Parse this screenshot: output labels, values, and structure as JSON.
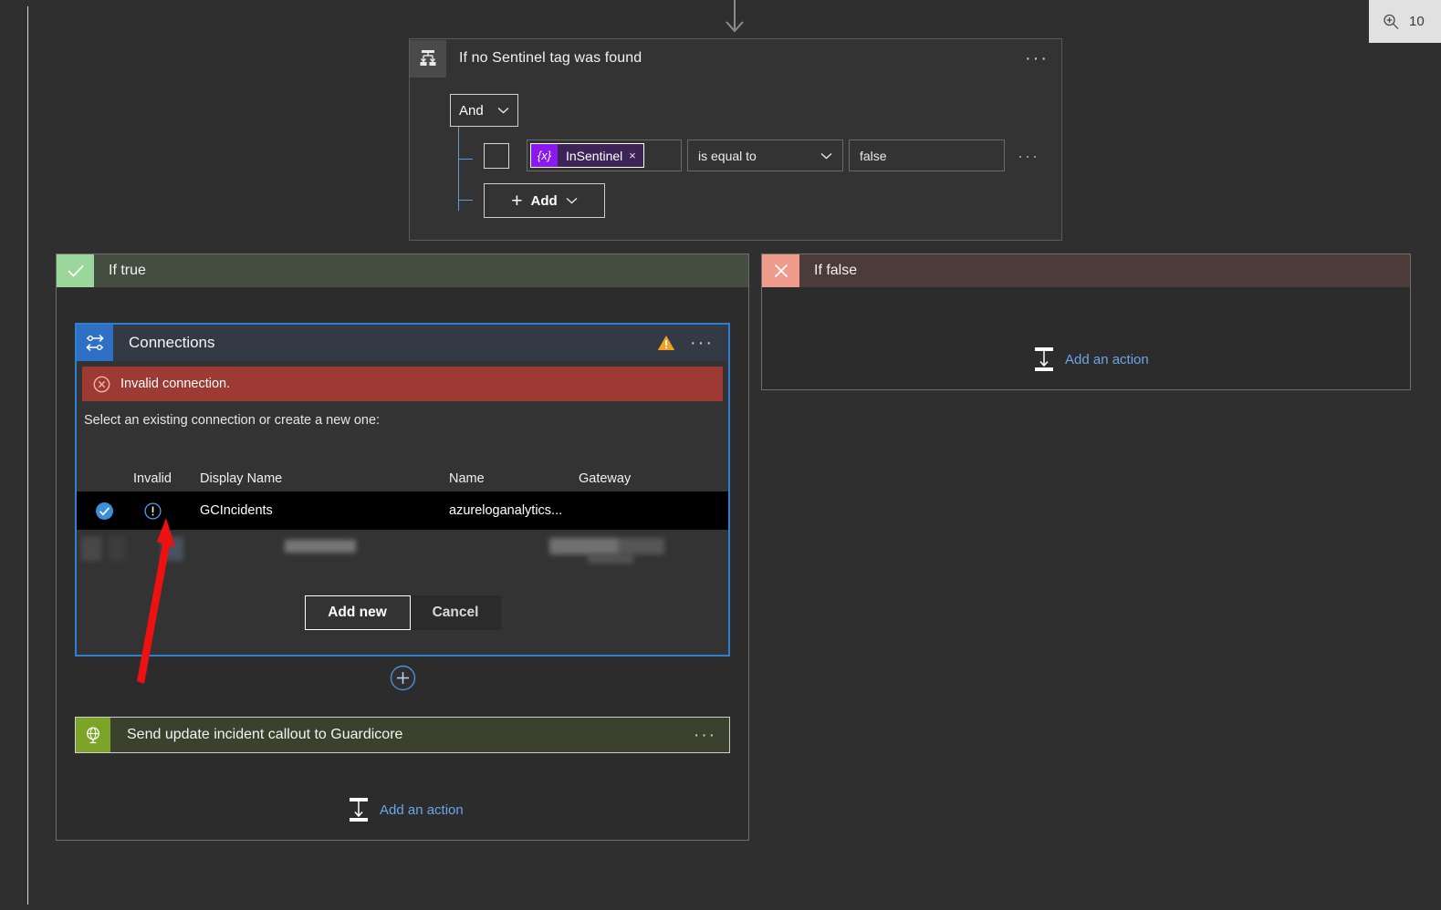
{
  "zoom_control": {
    "icon": "magnifier-plus-icon",
    "level": "10"
  },
  "condition_card": {
    "icon": "condition-icon",
    "title": "If no Sentinel tag was found",
    "more_label": "···",
    "logic_operator": "And",
    "row": {
      "token_icon": "{x}",
      "token_label": "InSentinel",
      "token_remove": "×",
      "operator": "is equal to",
      "value": "false",
      "more_label": "···"
    },
    "add_button": {
      "plus": "+",
      "label": "Add"
    }
  },
  "branches": {
    "true_branch": {
      "icon": "check-icon",
      "title": "If true",
      "add_action_label": "Add an action",
      "add_action_icon": "add-action-icon"
    },
    "false_branch": {
      "icon": "close-x-icon",
      "title": "If false",
      "add_action_label": "Add an action",
      "add_action_icon": "add-action-icon"
    }
  },
  "connections_panel": {
    "icon": "connections-icon",
    "title": "Connections",
    "warning_icon": "warning-triangle-icon",
    "more_label": "···",
    "error": {
      "icon": "error-circle-x-icon",
      "message": "Invalid connection."
    },
    "instruction": "Select an existing connection or create a new one:",
    "table": {
      "columns": [
        "",
        "Invalid",
        "Display Name",
        "Name",
        "Gateway"
      ],
      "rows": [
        {
          "selected": true,
          "select_icon": "checked-radio-icon",
          "invalid_icon": "invalid-exclamation-icon",
          "display_name": "GCIncidents",
          "name": "azureloganalytics...",
          "gateway": ""
        },
        {
          "selected": false,
          "redacted": true,
          "display_name": "",
          "name": "",
          "gateway": ""
        }
      ]
    },
    "buttons": {
      "add_new": "Add new",
      "cancel": "Cancel"
    }
  },
  "insert_node": {
    "icon": "plus-circle-icon",
    "label": "+"
  },
  "guardicore_action": {
    "icon": "http-globe-icon",
    "title": "Send update incident callout to Guardicore",
    "more_label": "···"
  },
  "annotation": {
    "arrow_color": "#ee1111",
    "points_to": "invalid-exclamation-icon"
  },
  "colors": {
    "canvas_bg": "#2f2f2f",
    "panel_bg": "#333333",
    "accent_blue": "#2f7fd1",
    "true_green": "#9bd69b",
    "false_salmon": "#ef9c8c",
    "error_red": "#9c3a33",
    "token_purple": "#8a18f0",
    "warning_orange": "#f2a01e",
    "guardicore_green": "#7ba428",
    "link_blue": "#6aa6e8",
    "annotation_red": "#ee1111"
  }
}
